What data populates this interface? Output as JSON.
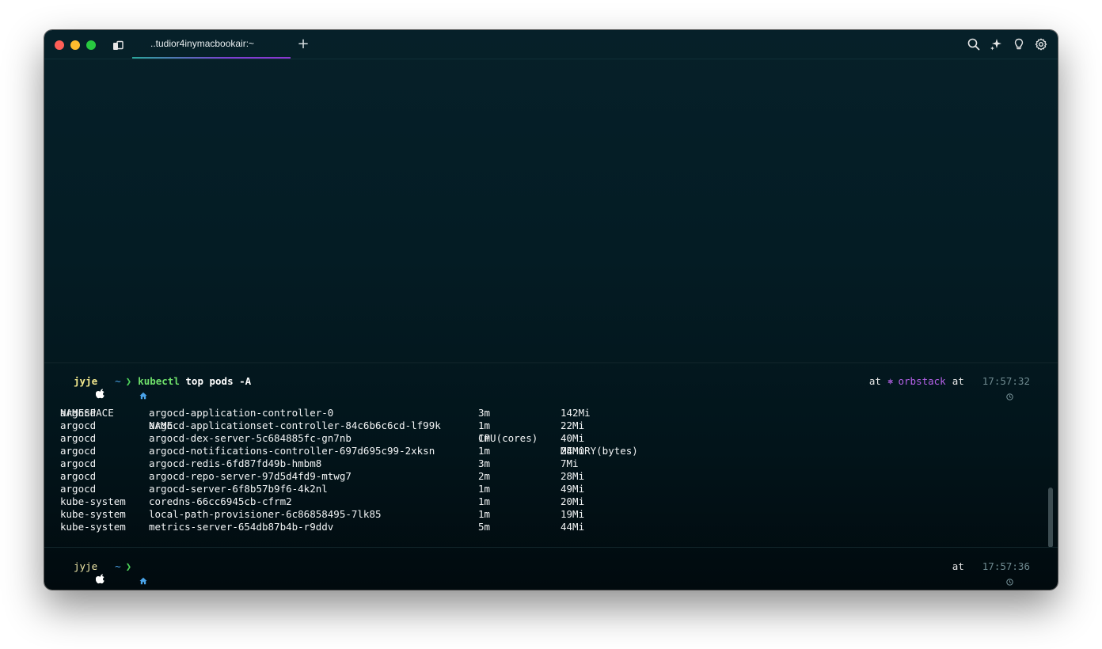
{
  "window": {
    "tab_title": "..tudior4inymacbookair:~",
    "new_tab_symbol": "+",
    "toolbar_icons": [
      "search-icon",
      "sparkle-icon",
      "lightbulb-icon",
      "gear-icon"
    ]
  },
  "prompt": {
    "user": "jyje",
    "dir": "~",
    "chevron": "❯",
    "command": "kubectl",
    "args": "top pods -A",
    "at_label": "at",
    "context_glyph": "⎈",
    "context": "orbstack",
    "time": "17:57:32"
  },
  "table": {
    "headers": [
      "NAMESPACE",
      "NAME",
      "CPU(cores)",
      "MEMORY(bytes)"
    ],
    "rows": [
      [
        "argocd",
        "argocd-application-controller-0",
        "3m",
        "142Mi"
      ],
      [
        "argocd",
        "argocd-applicationset-controller-84c6b6c6cd-lf99k",
        "1m",
        "22Mi"
      ],
      [
        "argocd",
        "argocd-dex-server-5c684885fc-gn7nb",
        "1m",
        "40Mi"
      ],
      [
        "argocd",
        "argocd-notifications-controller-697d695c99-2xksn",
        "1m",
        "24Mi"
      ],
      [
        "argocd",
        "argocd-redis-6fd87fd49b-hmbm8",
        "3m",
        "7Mi"
      ],
      [
        "argocd",
        "argocd-repo-server-97d5d4fd9-mtwg7",
        "2m",
        "28Mi"
      ],
      [
        "argocd",
        "argocd-server-6f8b57b9f6-4k2nl",
        "1m",
        "49Mi"
      ],
      [
        "kube-system",
        "coredns-66cc6945cb-cfrm2",
        "1m",
        "20Mi"
      ],
      [
        "kube-system",
        "local-path-provisioner-6c86858495-7lk85",
        "1m",
        "19Mi"
      ],
      [
        "kube-system",
        "metrics-server-654db87b4b-r9ddv",
        "5m",
        "44Mi"
      ]
    ]
  },
  "current_prompt": {
    "user": "jyje",
    "dir": "~",
    "chevron": "❯",
    "at_label": "at",
    "time": "17:57:36"
  },
  "colors": {
    "accent_green": "#6fe06b",
    "context_purple": "#b561e8",
    "user_yellow": "#f0e68c",
    "dir_blue": "#4aa3e8"
  }
}
